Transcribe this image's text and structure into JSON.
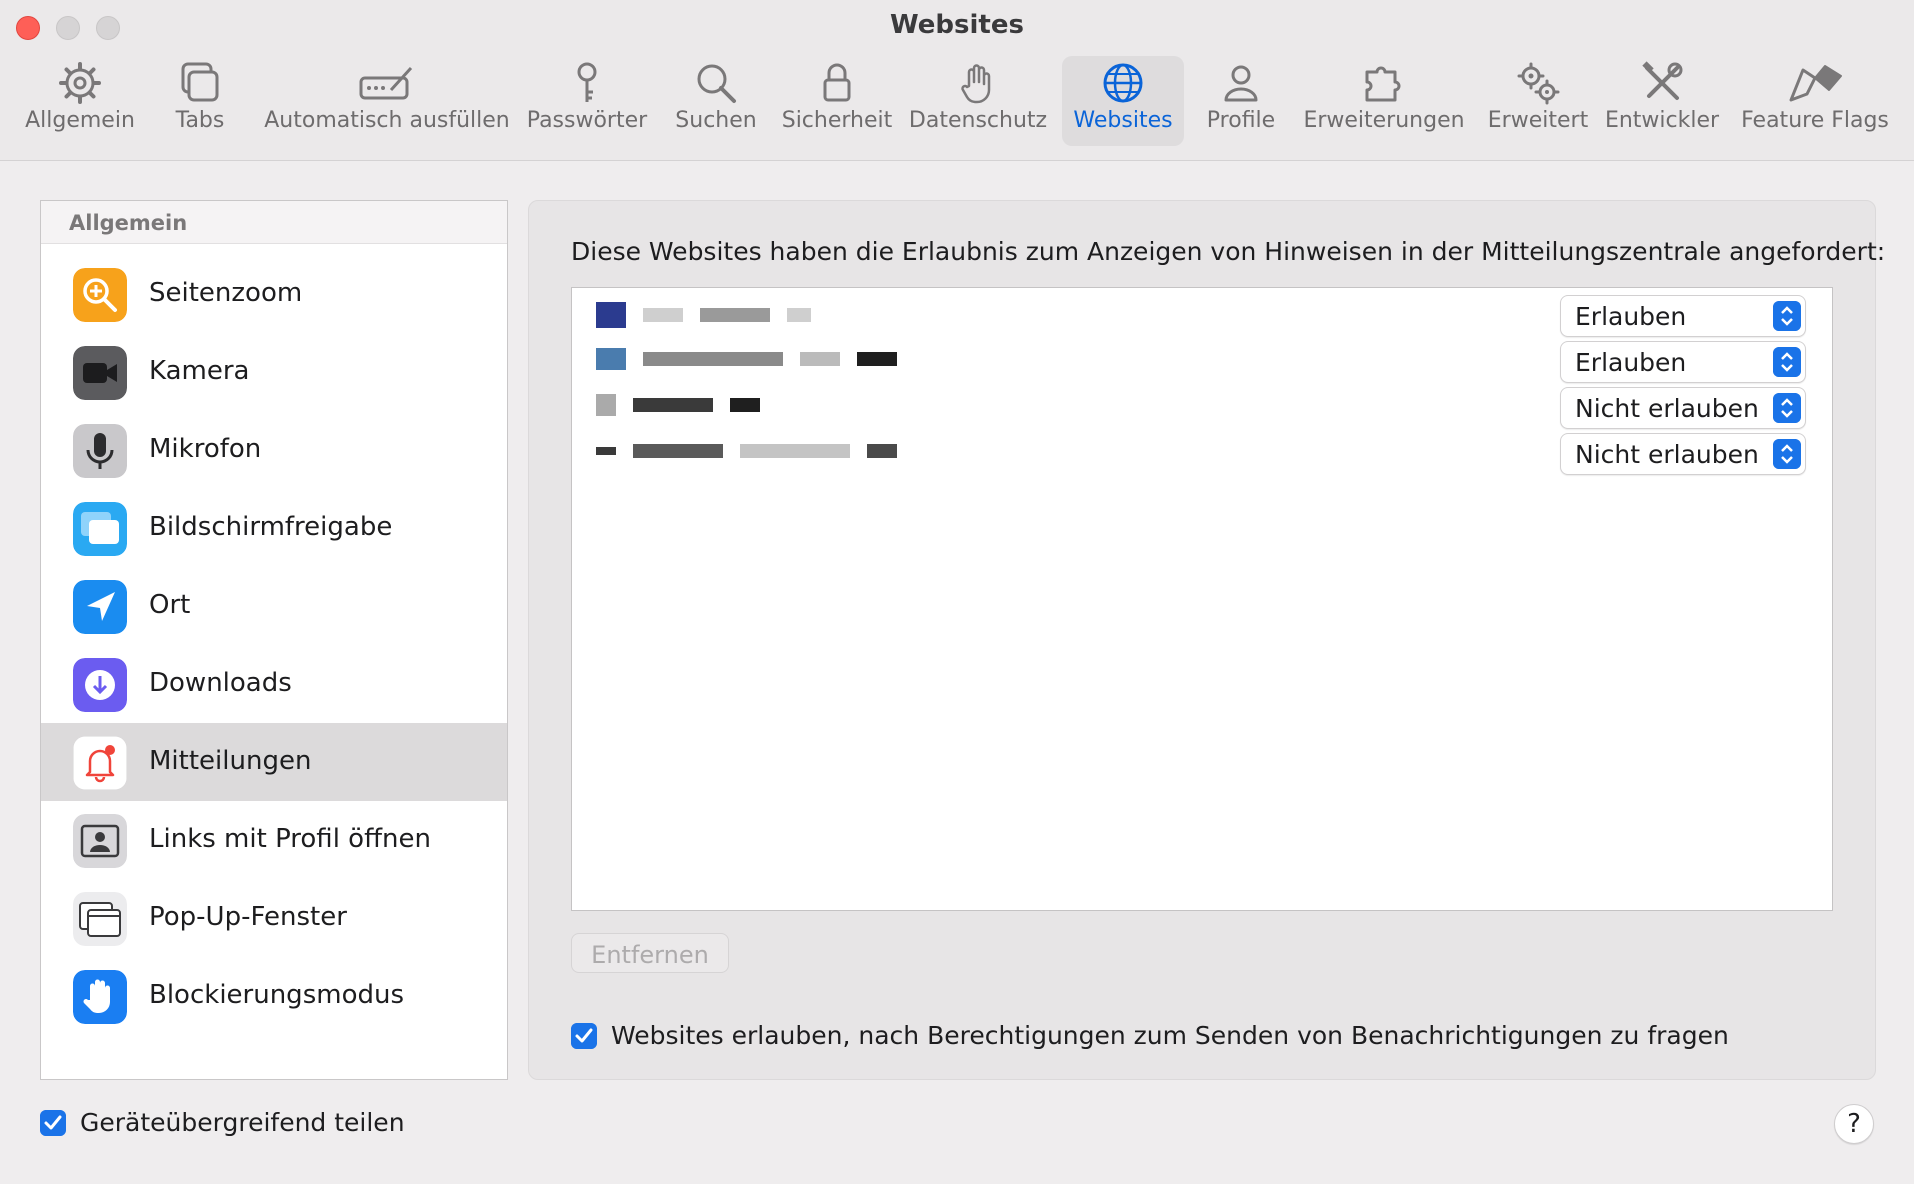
{
  "window": {
    "title": "Websites"
  },
  "toolbar": {
    "items": [
      {
        "label": "Allgemein",
        "icon": "gear-icon"
      },
      {
        "label": "Tabs",
        "icon": "tabs-icon"
      },
      {
        "label": "Automatisch ausfüllen",
        "icon": "autofill-icon"
      },
      {
        "label": "Passwörter",
        "icon": "key-icon"
      },
      {
        "label": "Suchen",
        "icon": "search-icon"
      },
      {
        "label": "Sicherheit",
        "icon": "lock-icon"
      },
      {
        "label": "Datenschutz",
        "icon": "hand-icon"
      },
      {
        "label": "Websites",
        "icon": "globe-icon",
        "active": true
      },
      {
        "label": "Profile",
        "icon": "person-icon"
      },
      {
        "label": "Erweiterungen",
        "icon": "puzzle-icon"
      },
      {
        "label": "Erweitert",
        "icon": "gears-icon"
      },
      {
        "label": "Entwickler",
        "icon": "tools-icon"
      },
      {
        "label": "Feature Flags",
        "icon": "flags-icon"
      }
    ]
  },
  "sidebar": {
    "header": "Allgemein",
    "items": [
      {
        "label": "Seitenzoom",
        "icon": "zoom-icon"
      },
      {
        "label": "Kamera",
        "icon": "camera-icon"
      },
      {
        "label": "Mikrofon",
        "icon": "microphone-icon"
      },
      {
        "label": "Bildschirmfreigabe",
        "icon": "screen-share-icon"
      },
      {
        "label": "Ort",
        "icon": "location-icon"
      },
      {
        "label": "Downloads",
        "icon": "download-icon"
      },
      {
        "label": "Mitteilungen",
        "icon": "bell-icon",
        "selected": true
      },
      {
        "label": "Links mit Profil öffnen",
        "icon": "profile-link-icon"
      },
      {
        "label": "Pop-Up-Fenster",
        "icon": "popup-window-icon"
      },
      {
        "label": "Blockierungsmodus",
        "icon": "block-hand-icon"
      }
    ]
  },
  "main": {
    "description": "Diese Websites haben die Erlaubnis zum Anzeigen von Hinweisen in der Mitteilungszentrale angefordert:",
    "sites": [
      {
        "setting": "Erlauben"
      },
      {
        "setting": "Erlauben"
      },
      {
        "setting": "Nicht erlauben"
      },
      {
        "setting": "Nicht erlauben"
      }
    ],
    "remove_label": "Entfernen",
    "ask_permission_label": "Websites erlauben, nach Berechtigungen zum Senden von Benachrichtigungen zu fragen",
    "ask_permission_checked": true
  },
  "footer": {
    "share_label": "Geräteübergreifend teilen",
    "share_checked": true,
    "help_label": "?"
  },
  "colors": {
    "accent": "#1a73e8",
    "active_tab_text": "#0a64d8",
    "close_button": "#fe5f57"
  }
}
